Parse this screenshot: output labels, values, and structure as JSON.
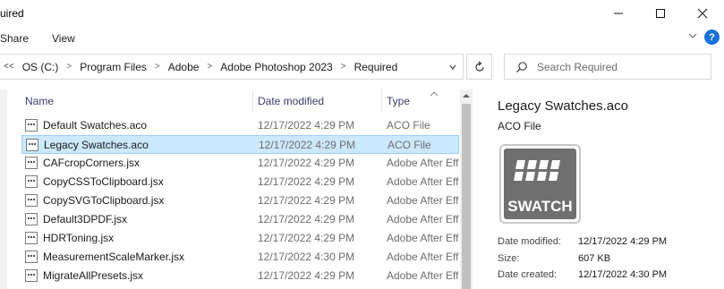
{
  "window": {
    "title": "uired"
  },
  "ribbon": {
    "tabs": [
      "Share",
      "View"
    ]
  },
  "address": {
    "segments": [
      "OS (C:)",
      "Program Files",
      "Adobe",
      "Adobe Photoshop 2023",
      "Required"
    ]
  },
  "search": {
    "placeholder": "Search Required"
  },
  "columns": {
    "name": "Name",
    "date": "Date modified",
    "type": "Type"
  },
  "files": [
    {
      "name": "Default Swatches.aco",
      "date": "12/17/2022 4:29 PM",
      "type": "ACO File",
      "icon": "swatch-file-icon",
      "selected": false
    },
    {
      "name": "Legacy Swatches.aco",
      "date": "12/17/2022 4:29 PM",
      "type": "ACO File",
      "icon": "swatch-file-icon",
      "selected": true
    },
    {
      "name": "CAFcropCorners.jsx",
      "date": "12/17/2022 4:29 PM",
      "type": "Adobe After Eff",
      "icon": "script-file-icon",
      "selected": false
    },
    {
      "name": "CopyCSSToClipboard.jsx",
      "date": "12/17/2022 4:29 PM",
      "type": "Adobe After Eff",
      "icon": "script-file-icon",
      "selected": false
    },
    {
      "name": "CopySVGToClipboard.jsx",
      "date": "12/17/2022 4:29 PM",
      "type": "Adobe After Eff",
      "icon": "script-file-icon",
      "selected": false
    },
    {
      "name": "Default3DPDF.jsx",
      "date": "12/17/2022 4:29 PM",
      "type": "Adobe After Eff",
      "icon": "script-file-icon",
      "selected": false
    },
    {
      "name": "HDRToning.jsx",
      "date": "12/17/2022 4:29 PM",
      "type": "Adobe After Eff",
      "icon": "script-file-icon",
      "selected": false
    },
    {
      "name": "MeasurementScaleMarker.jsx",
      "date": "12/17/2022 4:30 PM",
      "type": "Adobe After Eff",
      "icon": "script-file-icon",
      "selected": false
    },
    {
      "name": "MigrateAllPresets.jsx",
      "date": "12/17/2022 4:29 PM",
      "type": "Adobe After Eff",
      "icon": "script-file-icon",
      "selected": false
    }
  ],
  "details": {
    "name": "Legacy Swatches.aco",
    "type": "ACO File",
    "icon_label": "SWATCH",
    "modified_label": "Date modified:",
    "modified_value": "12/17/2022 4:29 PM",
    "size_label": "Size:",
    "size_value": "607 KB",
    "created_label": "Date created:",
    "created_value": "12/17/2022 4:30 PM"
  },
  "colors": {
    "selection_bg": "#cce8ff",
    "selection_border": "#99d1ff",
    "header_text": "#3c3c6b",
    "help_blue": "#1a73d9"
  }
}
